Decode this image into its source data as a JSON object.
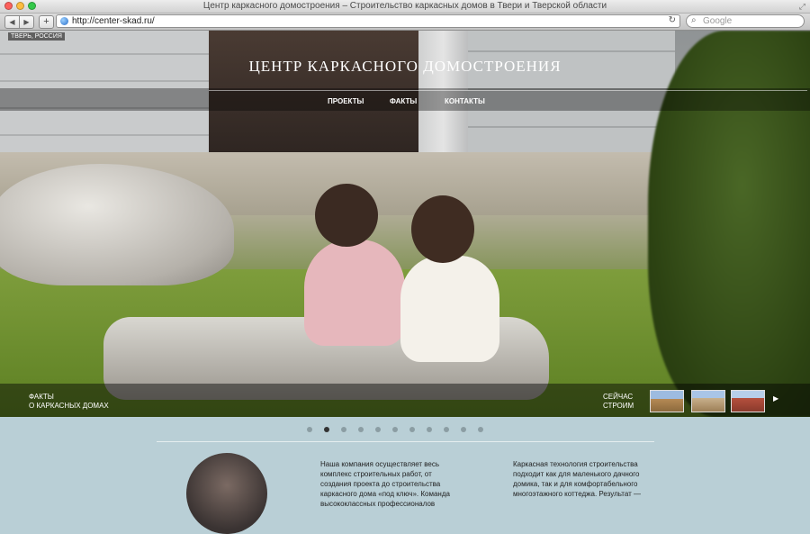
{
  "browser": {
    "window_title": "Центр каркасного домостроения – Строительство каркасных домов в Твери и Тверской области",
    "url": "http://center-skad.ru/",
    "search_placeholder": "Google",
    "back_icon": "◀",
    "forward_icon": "▶",
    "add_icon": "+",
    "reload_icon": "↻",
    "search_icon": "⌕",
    "resize_icon": "⤢"
  },
  "header": {
    "location": "ТВЕРЬ, РОССИЯ",
    "site_title": "ЦЕНТР КАРКАСНОГО ДОМОСТРОЕНИЯ",
    "nav": [
      "ПРОЕКТЫ",
      "ФАКТЫ",
      "КОНТАКТЫ"
    ]
  },
  "hero_bar": {
    "facts_line1": "ФАКТЫ",
    "facts_line2": "О КАРКАСНЫХ ДОМАХ",
    "now_line1": "СЕЙЧАС",
    "now_line2": "СТРОИМ",
    "next_icon": "▶"
  },
  "slider": {
    "count": 11,
    "active_index": 1
  },
  "content": {
    "col1": "Наша компания осуществляет весь комплекс строительных работ, от создания проекта до строительства каркасного дома «под ключ». Команда высококлассных профессионалов",
    "col2": "Каркасная технология строительства подходит как для маленького дачного домика, так и для комфортабельного многоэтажного коттеджа. Результат —"
  }
}
